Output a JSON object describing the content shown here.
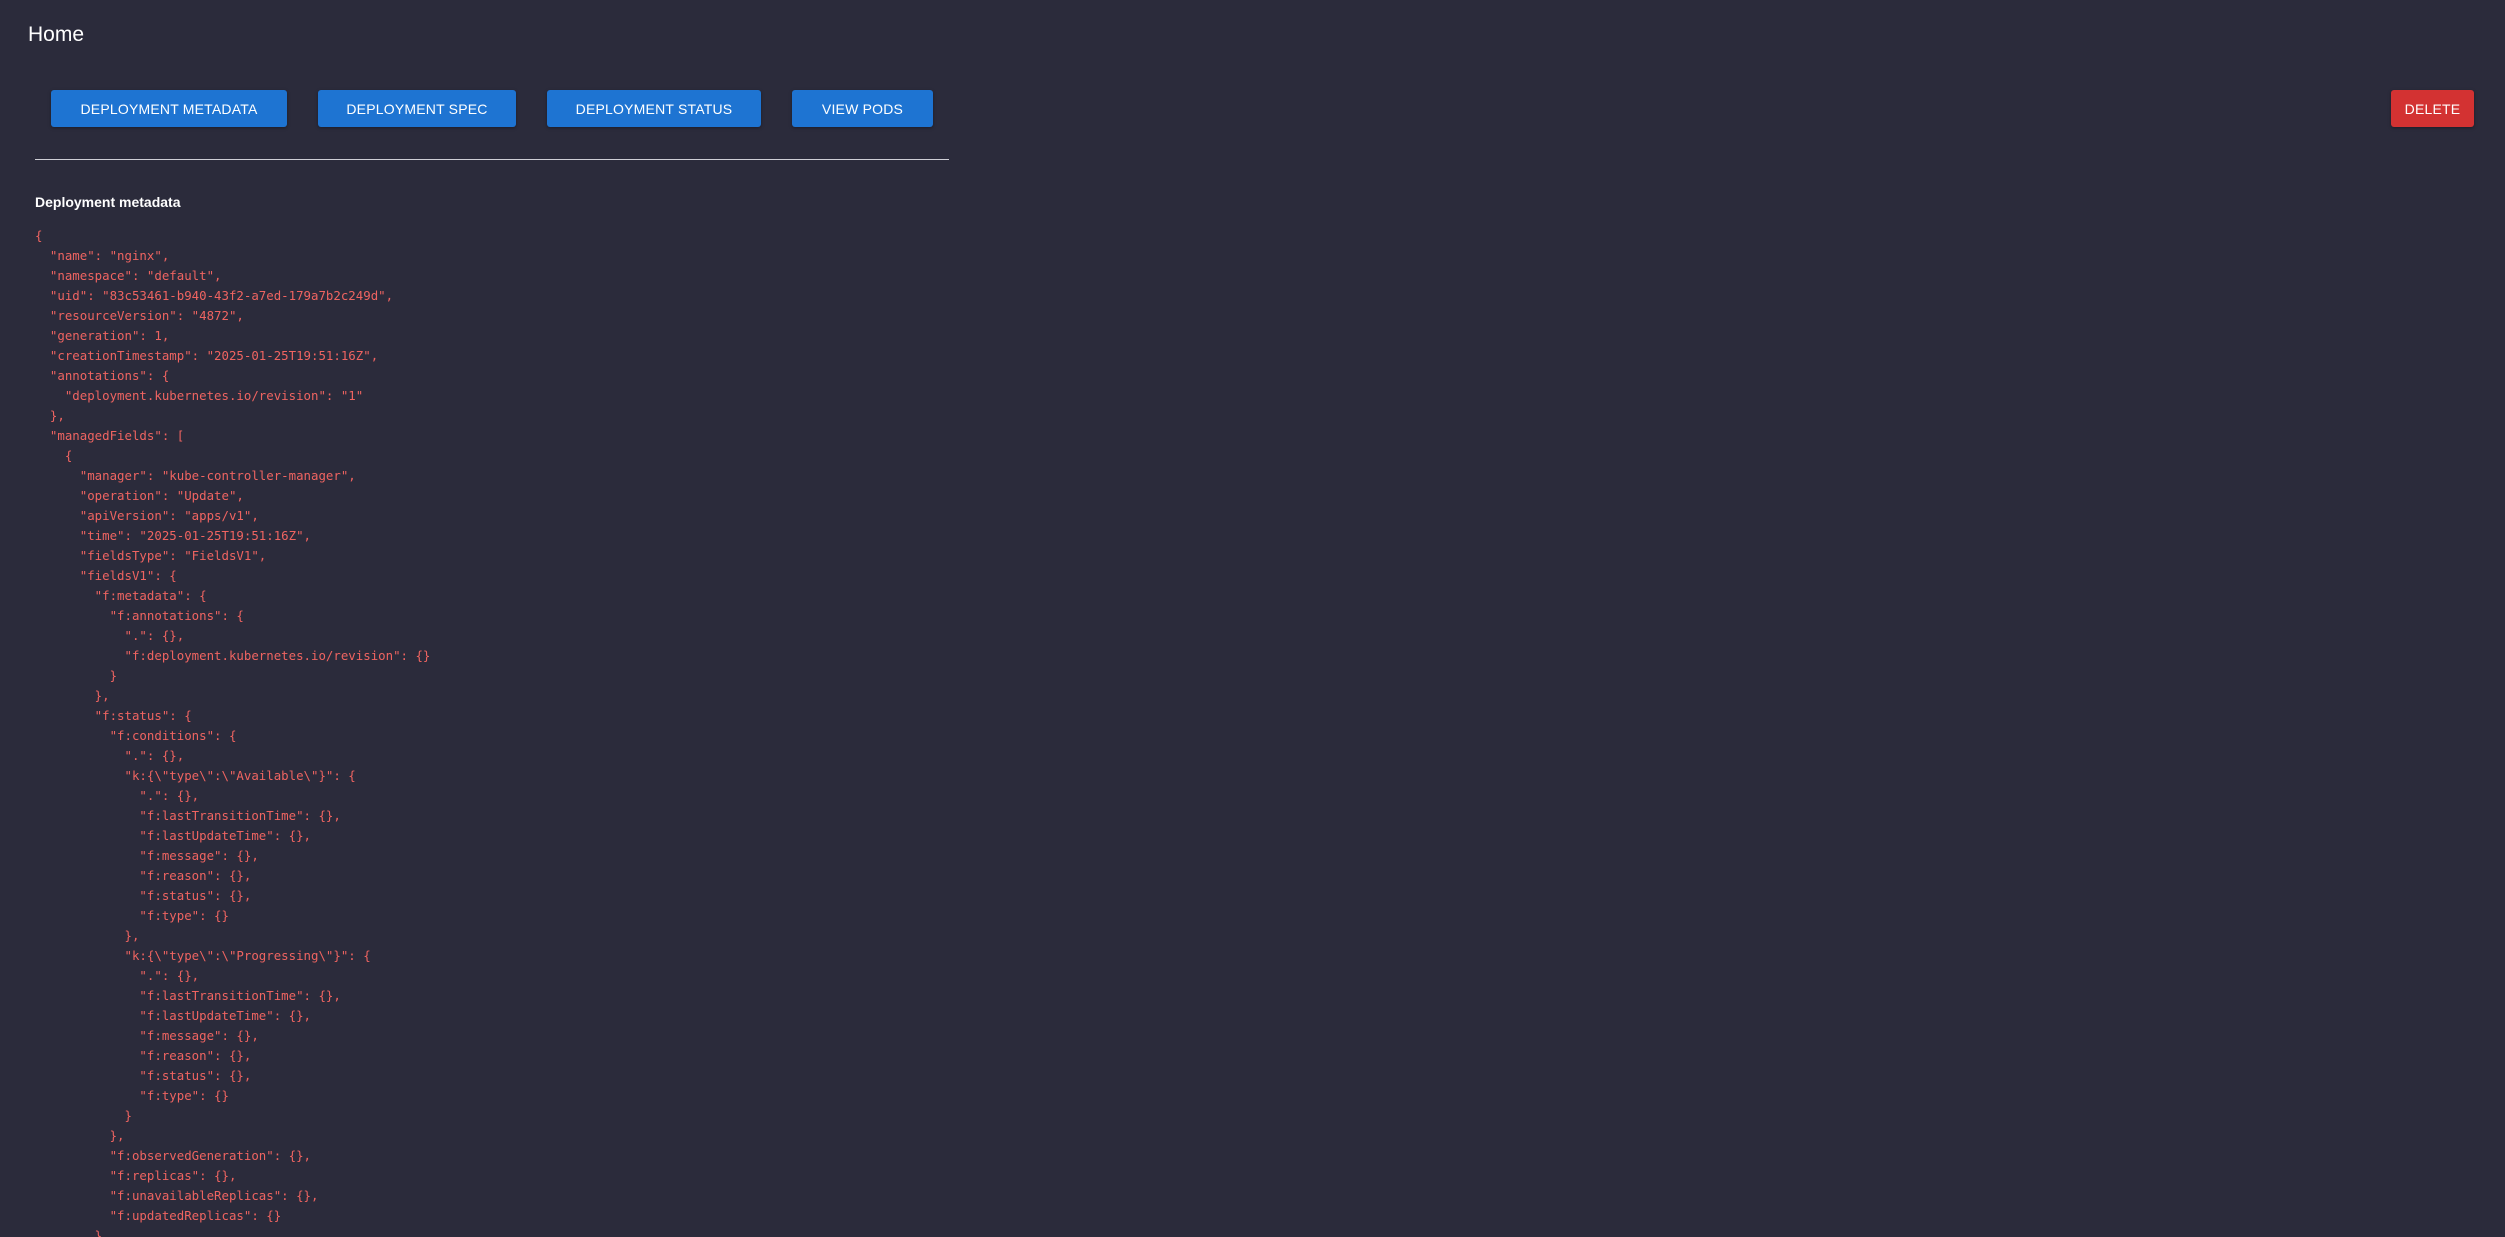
{
  "header": {
    "title": "Home"
  },
  "toolbar": {
    "metadata_label": "DEPLOYMENT METADATA",
    "spec_label": "DEPLOYMENT SPEC",
    "status_label": "DEPLOYMENT STATUS",
    "pods_label": "VIEW PODS",
    "delete_label": "DELETE"
  },
  "section": {
    "heading": "Deployment metadata"
  },
  "metadata_json": "{\n  \"name\": \"nginx\",\n  \"namespace\": \"default\",\n  \"uid\": \"83c53461-b940-43f2-a7ed-179a7b2c249d\",\n  \"resourceVersion\": \"4872\",\n  \"generation\": 1,\n  \"creationTimestamp\": \"2025-01-25T19:51:16Z\",\n  \"annotations\": {\n    \"deployment.kubernetes.io/revision\": \"1\"\n  },\n  \"managedFields\": [\n    {\n      \"manager\": \"kube-controller-manager\",\n      \"operation\": \"Update\",\n      \"apiVersion\": \"apps/v1\",\n      \"time\": \"2025-01-25T19:51:16Z\",\n      \"fieldsType\": \"FieldsV1\",\n      \"fieldsV1\": {\n        \"f:metadata\": {\n          \"f:annotations\": {\n            \".\": {},\n            \"f:deployment.kubernetes.io/revision\": {}\n          }\n        },\n        \"f:status\": {\n          \"f:conditions\": {\n            \".\": {},\n            \"k:{\\\"type\\\":\\\"Available\\\"}\": {\n              \".\": {},\n              \"f:lastTransitionTime\": {},\n              \"f:lastUpdateTime\": {},\n              \"f:message\": {},\n              \"f:reason\": {},\n              \"f:status\": {},\n              \"f:type\": {}\n            },\n            \"k:{\\\"type\\\":\\\"Progressing\\\"}\": {\n              \".\": {},\n              \"f:lastTransitionTime\": {},\n              \"f:lastUpdateTime\": {},\n              \"f:message\": {},\n              \"f:reason\": {},\n              \"f:status\": {},\n              \"f:type\": {}\n            }\n          },\n          \"f:observedGeneration\": {},\n          \"f:replicas\": {},\n          \"f:unavailableReplicas\": {},\n          \"f:updatedReplicas\": {}\n        }",
  "colors": {
    "background": "#2b2b3b",
    "primary_button": "#1e74d2",
    "danger_button": "#d33232",
    "json_text": "#ef6461",
    "heading_text": "#ffffff"
  }
}
